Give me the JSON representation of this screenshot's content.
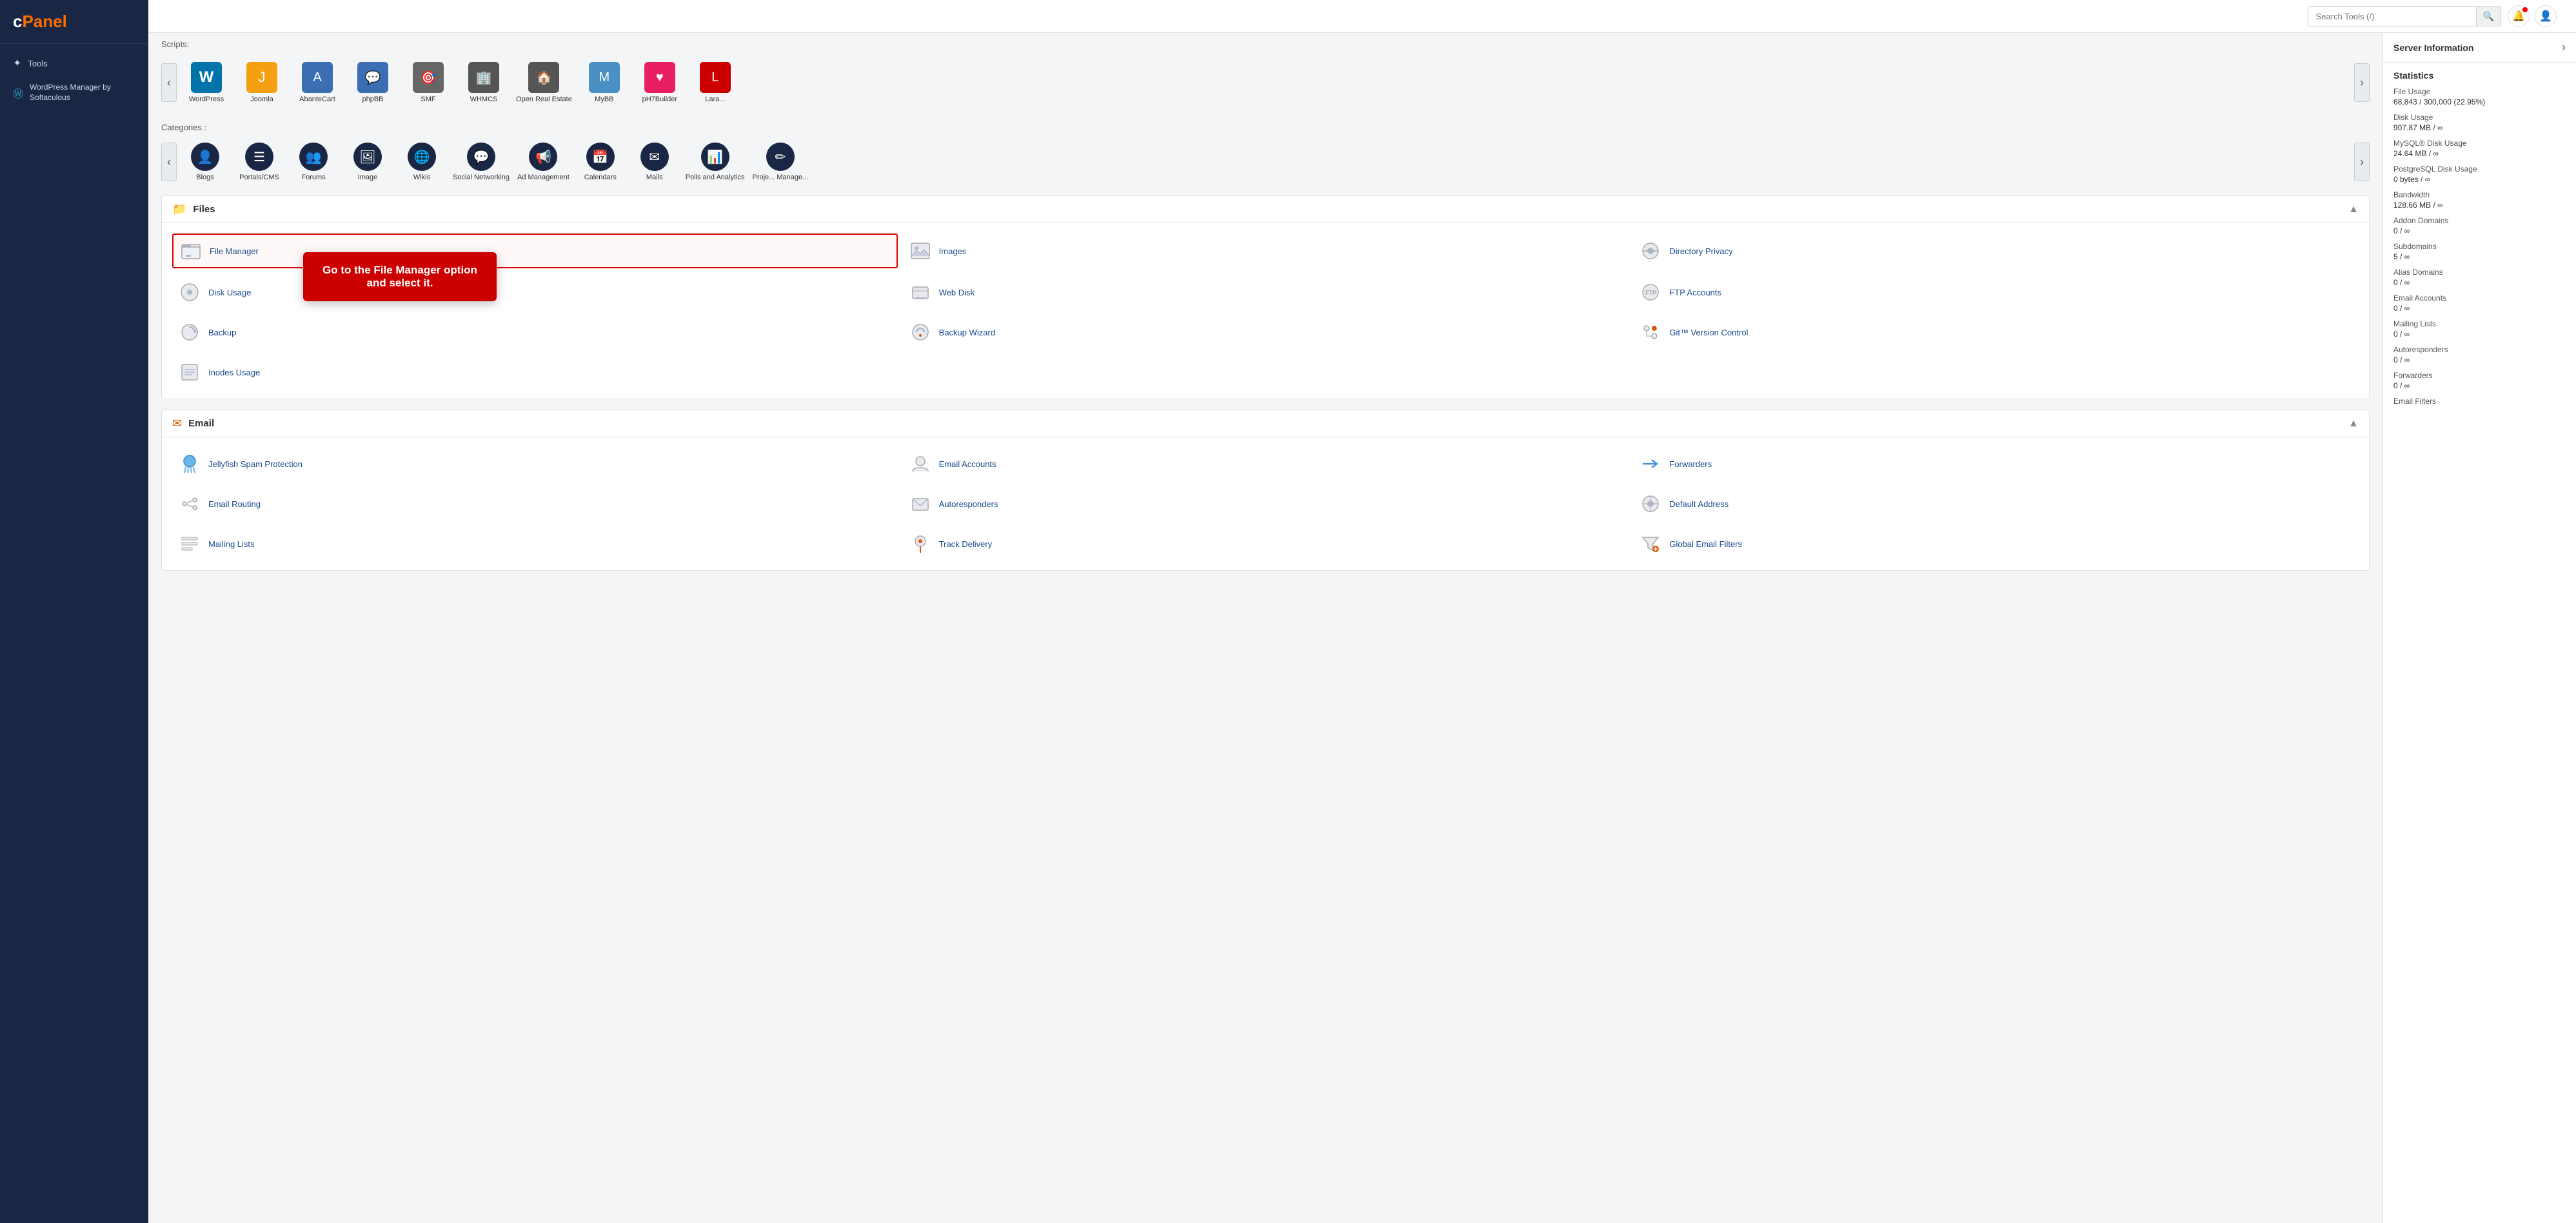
{
  "sidebar": {
    "logo": "cPanel",
    "items": [
      {
        "id": "tools",
        "label": "Tools",
        "icon": "✦"
      },
      {
        "id": "wordpress-manager",
        "label": "WordPress Manager by Softaculous",
        "icon": "Ⓦ"
      }
    ]
  },
  "topbar": {
    "search_placeholder": "Search Tools (/)",
    "search_label": "Search Tools (/)"
  },
  "right_sidebar": {
    "server_information": {
      "title": "Server Information",
      "chevron": "›"
    },
    "statistics": {
      "title": "Statistics",
      "items": [
        {
          "label": "File Usage",
          "value": "68,843 / 300,000  (22.95%)"
        },
        {
          "label": "Disk Usage",
          "value": "907.87 MB / ∞"
        },
        {
          "label": "MySQL® Disk Usage",
          "value": "24.64 MB / ∞"
        },
        {
          "label": "PostgreSQL Disk Usage",
          "value": "0 bytes / ∞"
        },
        {
          "label": "Bandwidth",
          "value": "128.66 MB / ∞"
        },
        {
          "label": "Addon Domains",
          "value": "0 / ∞"
        },
        {
          "label": "Subdomains",
          "value": "5 / ∞"
        },
        {
          "label": "Alias Domains",
          "value": "0 / ∞"
        },
        {
          "label": "Email Accounts",
          "value": "0 / ∞"
        },
        {
          "label": "Mailing Lists",
          "value": "0 / ∞"
        },
        {
          "label": "Autoresponders",
          "value": "0 / ∞"
        },
        {
          "label": "Forwarders",
          "value": "0 / ∞"
        },
        {
          "label": "Email Filters",
          "value": ""
        }
      ]
    }
  },
  "scripts_label": "Scripts:",
  "categories_label": "Categories :",
  "scripts": [
    {
      "id": "wordpress",
      "label": "WordPress",
      "icon": "🔵",
      "bg": "#0073aa"
    },
    {
      "id": "joomla",
      "label": "Joomla",
      "icon": "⬡",
      "bg": "#f4a010"
    },
    {
      "id": "abantecart",
      "label": "AbanteCart",
      "icon": "🅐",
      "bg": "#3c6eb4"
    },
    {
      "id": "phpbb",
      "label": "phpBB",
      "icon": "💬",
      "bg": "#3c6eb4"
    },
    {
      "id": "smf",
      "label": "SMF",
      "icon": "🎯",
      "bg": "#666"
    },
    {
      "id": "whmcs",
      "label": "WHMCS",
      "icon": "🏢",
      "bg": "#555"
    },
    {
      "id": "open-real-estate",
      "label": "Open Real Estate",
      "icon": "🏠",
      "bg": "#555"
    },
    {
      "id": "mybb",
      "label": "MyBB",
      "icon": "🔵",
      "bg": "#555"
    },
    {
      "id": "ph7builder",
      "label": "pH7Builder",
      "icon": "💙",
      "bg": "#555"
    },
    {
      "id": "lara",
      "label": "Lara...",
      "icon": "🔴",
      "bg": "#c00"
    }
  ],
  "categories": [
    {
      "id": "blogs",
      "label": "Blogs",
      "icon": "👤"
    },
    {
      "id": "portals-cms",
      "label": "Portals/CMS",
      "icon": "☰"
    },
    {
      "id": "forums",
      "label": "Forums",
      "icon": "👥"
    },
    {
      "id": "image",
      "label": "Image",
      "icon": "🖼"
    },
    {
      "id": "wikis",
      "label": "Wikis",
      "icon": "🌐"
    },
    {
      "id": "social-networking",
      "label": "Social Networking",
      "icon": "💬"
    },
    {
      "id": "ad-management",
      "label": "Ad Management",
      "icon": "📢"
    },
    {
      "id": "calendars",
      "label": "Calendars",
      "icon": "📅"
    },
    {
      "id": "mails",
      "label": "Mails",
      "icon": "✉"
    },
    {
      "id": "polls-analytics",
      "label": "Polls and Analytics",
      "icon": "📊"
    },
    {
      "id": "project-manage",
      "label": "Proje... Manage...",
      "icon": "✏"
    }
  ],
  "tooltip": {
    "text": "Go to the File Manager option and select it."
  },
  "files_section": {
    "title": "Files",
    "icon": "📁",
    "items": [
      {
        "id": "file-manager",
        "label": "File Manager",
        "icon": "📁",
        "highlighted": true
      },
      {
        "id": "images",
        "label": "Images",
        "icon": "🖼"
      },
      {
        "id": "directory-privacy",
        "label": "Directory Privacy",
        "icon": "👁"
      },
      {
        "id": "disk-usage",
        "label": "Disk Usage",
        "icon": "💾"
      },
      {
        "id": "web-disk",
        "label": "Web Disk",
        "icon": "💻"
      },
      {
        "id": "ftp-accounts",
        "label": "FTP Accounts",
        "icon": "🔗"
      },
      {
        "id": "backup",
        "label": "Backup",
        "icon": "🔄"
      },
      {
        "id": "backup-wizard",
        "label": "Backup Wizard",
        "icon": "🔄"
      },
      {
        "id": "git-version-control",
        "label": "Git™ Version Control",
        "icon": "⚙"
      },
      {
        "id": "inodes-usage",
        "label": "Inodes Usage",
        "icon": "🔢"
      }
    ]
  },
  "email_section": {
    "title": "Email",
    "icon": "✉",
    "items": [
      {
        "id": "jellyfish-spam",
        "label": "Jellyfish Spam Protection",
        "icon": "🛡"
      },
      {
        "id": "email-accounts",
        "label": "Email Accounts",
        "icon": "👤"
      },
      {
        "id": "forwarders",
        "label": "Forwarders",
        "icon": "➡"
      },
      {
        "id": "email-routing",
        "label": "Email Routing",
        "icon": "⚙"
      },
      {
        "id": "autoresponders",
        "label": "Autoresponders",
        "icon": "✉"
      },
      {
        "id": "default-address",
        "label": "Default Address",
        "icon": "🔍"
      },
      {
        "id": "mailing-lists",
        "label": "Mailing Lists",
        "icon": "☰"
      },
      {
        "id": "track-delivery",
        "label": "Track Delivery",
        "icon": "📍"
      },
      {
        "id": "global-email-filters",
        "label": "Global Email Filters",
        "icon": "🔽"
      }
    ]
  }
}
